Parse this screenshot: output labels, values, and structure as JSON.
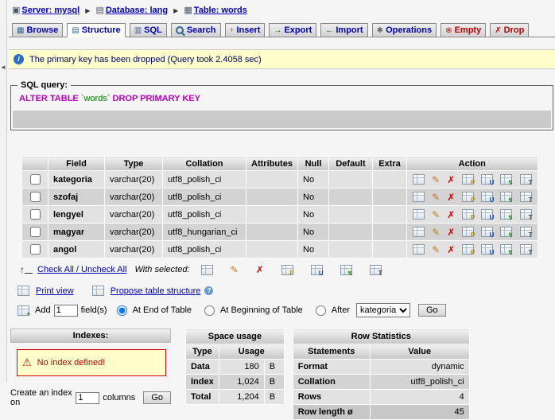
{
  "frame": {
    "collapse_arrow": "◄"
  },
  "icons": {
    "server": "▣",
    "database": "▤",
    "table": "▦",
    "separator": "▶",
    "info": "i",
    "warning": "⚠",
    "help": "?",
    "check_arrow": "↑",
    "printer": "▤",
    "propose": "▦",
    "add": "+"
  },
  "breadcrumb": {
    "server": "Server: mysql",
    "database": "Database: lang",
    "table": "Table: words"
  },
  "tabs": [
    {
      "label": "Browse",
      "icon": "▦"
    },
    {
      "label": "Structure",
      "icon": "▤"
    },
    {
      "label": "SQL",
      "icon": "▥"
    },
    {
      "label": "Search",
      "icon": ""
    },
    {
      "label": "Insert",
      "icon": "+"
    },
    {
      "label": "Export",
      "icon": "→"
    },
    {
      "label": "Import",
      "icon": "←"
    },
    {
      "label": "Operations",
      "icon": "✱"
    },
    {
      "label": "Empty",
      "icon": "⊗"
    },
    {
      "label": "Drop",
      "icon": "✗"
    }
  ],
  "notice": {
    "text": "The primary key has been dropped (Query took 2.4058 sec)"
  },
  "sql_query": {
    "legend": "SQL query:",
    "keyword_alter": "ALTER TABLE",
    "table_name": "`words`",
    "keyword_drop": "DROP PRIMARY KEY"
  },
  "structure": {
    "headers": {
      "field": "Field",
      "type": "Type",
      "collation": "Collation",
      "attributes": "Attributes",
      "null": "Null",
      "default": "Default",
      "extra": "Extra",
      "action": "Action"
    },
    "rows": [
      {
        "field": "kategoria",
        "type": "varchar(20)",
        "collation": "utf8_polish_ci",
        "attributes": "",
        "null": "No",
        "default": "",
        "extra": ""
      },
      {
        "field": "szofaj",
        "type": "varchar(20)",
        "collation": "utf8_polish_ci",
        "attributes": "",
        "null": "No",
        "default": "",
        "extra": ""
      },
      {
        "field": "lengyel",
        "type": "varchar(20)",
        "collation": "utf8_polish_ci",
        "attributes": "",
        "null": "No",
        "default": "",
        "extra": ""
      },
      {
        "field": "magyar",
        "type": "varchar(20)",
        "collation": "utf8_hungarian_ci",
        "attributes": "",
        "null": "No",
        "default": "",
        "extra": ""
      },
      {
        "field": "angol",
        "type": "varchar(20)",
        "collation": "utf8_polish_ci",
        "attributes": "",
        "null": "No",
        "default": "",
        "extra": ""
      }
    ],
    "check_all": "Check All / Uncheck All",
    "with_selected": "With selected:"
  },
  "action_icons": {
    "primary_mark": "P",
    "unique_mark": "U",
    "index_mark": "↯",
    "fulltext_mark": "T"
  },
  "toolbar_links": {
    "print_view": "Print view",
    "propose_structure": "Propose table structure"
  },
  "add_field": {
    "add_label": "Add",
    "count": "1",
    "fields_label": "field(s)",
    "opt_end": "At End of Table",
    "opt_begin": "At Beginning of Table",
    "opt_after": "After",
    "after_selected": "kategoria",
    "go": "Go"
  },
  "indexes": {
    "title": "Indexes:",
    "no_index": "No index defined!",
    "create_prefix": "Create an index on",
    "columns_count": "1",
    "columns_label": "columns",
    "go": "Go"
  },
  "space_usage": {
    "title": "Space usage",
    "col_type": "Type",
    "col_usage": "Usage",
    "rows": [
      {
        "type": "Data",
        "value": "180",
        "unit": "B"
      },
      {
        "type": "Index",
        "value": "1,024",
        "unit": "B"
      },
      {
        "type": "Total",
        "value": "1,204",
        "unit": "B"
      }
    ]
  },
  "row_statistics": {
    "title": "Row Statistics",
    "col_statements": "Statements",
    "col_value": "Value",
    "rows": [
      {
        "stmt": "Format",
        "value": "dynamic"
      },
      {
        "stmt": "Collation",
        "value": "utf8_polish_ci"
      },
      {
        "stmt": "Rows",
        "value": "4"
      },
      {
        "stmt": "Row length ø",
        "value": "45"
      }
    ]
  }
}
